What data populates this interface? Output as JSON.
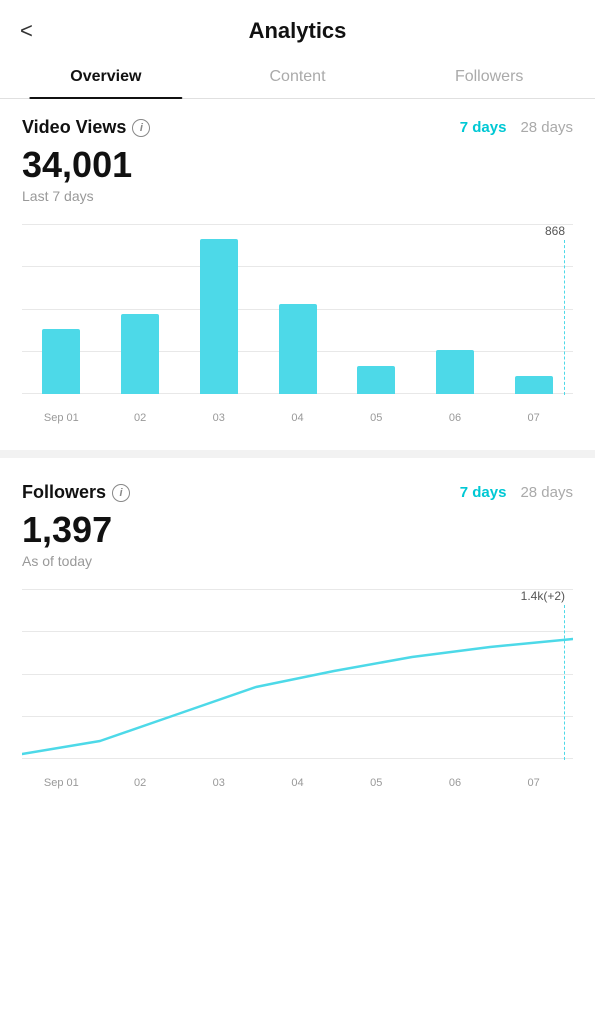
{
  "header": {
    "back_label": "<",
    "title": "Analytics"
  },
  "tabs": [
    {
      "label": "Overview",
      "active": true
    },
    {
      "label": "Content",
      "active": false
    },
    {
      "label": "Followers",
      "active": false
    }
  ],
  "video_views": {
    "title": "Video Views",
    "info_icon": "i",
    "period_7": "7 days",
    "period_28": "28 days",
    "value": "34,001",
    "sub_label": "Last 7 days",
    "annotation_value": "868",
    "bars": [
      {
        "label": "Sep 01",
        "height_pct": 0.42
      },
      {
        "label": "02",
        "height_pct": 0.52
      },
      {
        "label": "03",
        "height_pct": 1.0
      },
      {
        "label": "04",
        "height_pct": 0.58
      },
      {
        "label": "05",
        "height_pct": 0.18
      },
      {
        "label": "06",
        "height_pct": 0.28
      },
      {
        "label": "07",
        "height_pct": 0.12
      }
    ]
  },
  "followers": {
    "title": "Followers",
    "info_icon": "i",
    "period_7": "7 days",
    "period_28": "28 days",
    "value": "1,397",
    "sub_label": "As of today",
    "annotation_value": "1.4k(+2)",
    "x_labels": [
      "Sep 01",
      "02",
      "03",
      "04",
      "05",
      "06",
      "07"
    ]
  },
  "colors": {
    "accent_cyan": "#4dd9e8",
    "active_tab_underline": "#111111",
    "grid_line": "#e8e8e8",
    "text_primary": "#111111",
    "text_secondary": "#999999"
  }
}
